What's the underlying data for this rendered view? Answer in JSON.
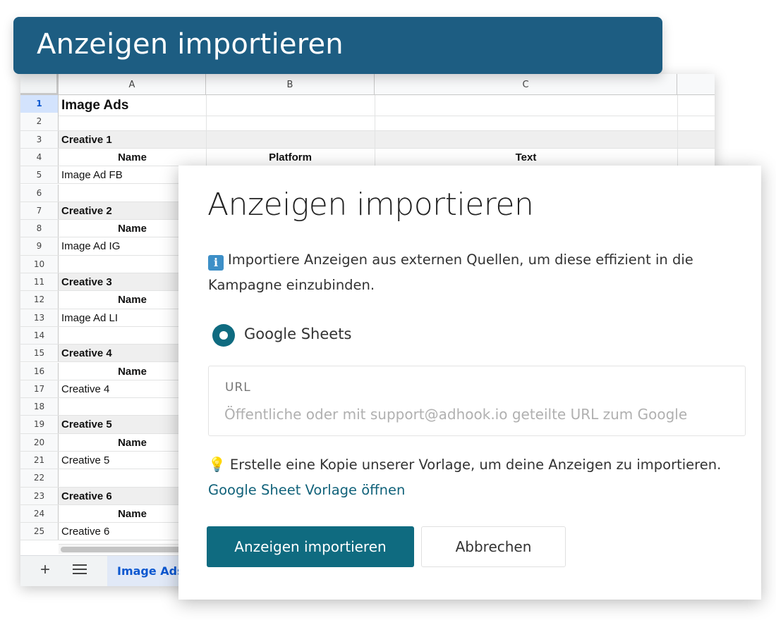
{
  "banner": {
    "title": "Anzeigen importieren"
  },
  "sheet": {
    "columns": [
      "A",
      "B",
      "C"
    ],
    "rows": [
      {
        "num": "1",
        "a": "Image Ads",
        "b": "",
        "c": ""
      },
      {
        "num": "2",
        "a": "",
        "b": "",
        "c": ""
      },
      {
        "num": "3",
        "a": "Creative 1",
        "b": "",
        "c": ""
      },
      {
        "num": "4",
        "a": "Name",
        "b": "Platform",
        "c": "Text"
      },
      {
        "num": "5",
        "a": "Image Ad FB",
        "b": "",
        "c": ""
      },
      {
        "num": "6",
        "a": "",
        "b": "",
        "c": ""
      },
      {
        "num": "7",
        "a": "Creative 2",
        "b": "",
        "c": ""
      },
      {
        "num": "8",
        "a": "Name",
        "b": "",
        "c": ""
      },
      {
        "num": "9",
        "a": "Image Ad IG",
        "b": "",
        "c": ""
      },
      {
        "num": "10",
        "a": "",
        "b": "",
        "c": ""
      },
      {
        "num": "11",
        "a": "Creative 3",
        "b": "",
        "c": ""
      },
      {
        "num": "12",
        "a": "Name",
        "b": "",
        "c": ""
      },
      {
        "num": "13",
        "a": "Image Ad LI",
        "b": "",
        "c": ""
      },
      {
        "num": "14",
        "a": "",
        "b": "",
        "c": ""
      },
      {
        "num": "15",
        "a": "Creative 4",
        "b": "",
        "c": ""
      },
      {
        "num": "16",
        "a": "Name",
        "b": "",
        "c": ""
      },
      {
        "num": "17",
        "a": "Creative 4",
        "b": "",
        "c": ""
      },
      {
        "num": "18",
        "a": "",
        "b": "",
        "c": ""
      },
      {
        "num": "19",
        "a": "Creative 5",
        "b": "",
        "c": ""
      },
      {
        "num": "20",
        "a": "Name",
        "b": "",
        "c": ""
      },
      {
        "num": "21",
        "a": "Creative 5",
        "b": "",
        "c": ""
      },
      {
        "num": "22",
        "a": "",
        "b": "",
        "c": ""
      },
      {
        "num": "23",
        "a": "Creative 6",
        "b": "",
        "c": ""
      },
      {
        "num": "24",
        "a": "Name",
        "b": "",
        "c": ""
      },
      {
        "num": "25",
        "a": "Creative 6",
        "b": "",
        "c": ""
      }
    ],
    "tabbar": {
      "add_label": "+",
      "active_tab": "Image Ads"
    }
  },
  "dialog": {
    "title": "Anzeigen importieren",
    "info_icon": "i",
    "info_text": "Importiere Anzeigen aus externen Quellen, um diese effizient in die Kampagne einzubinden.",
    "radio_label": "Google Sheets",
    "url_label": "URL",
    "url_placeholder": "Öffentliche oder mit support@adhook.io geteilte URL zum Google",
    "hint_icon": "💡",
    "hint_text": "Erstelle eine Kopie unserer Vorlage, um deine Anzeigen zu importieren.",
    "hint_link": "Google Sheet Vorlage öffnen",
    "primary_button": "Anzeigen importieren",
    "secondary_button": "Abbrechen",
    "accent_color": "#0f6b80"
  }
}
